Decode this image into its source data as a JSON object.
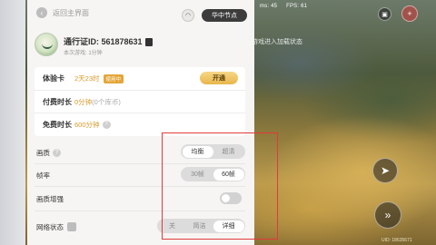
{
  "hud": {
    "fps": "FPS: 61",
    "ping": "ms: 45",
    "overlay_text": "云游戏进入加载状态",
    "bottom_text": "UID: 18635671"
  },
  "header": {
    "back_label": "返回主界面",
    "node_label": "华中节点"
  },
  "profile": {
    "pass_id": "通行证ID: 561878631",
    "session": "本次游戏: 1分钟"
  },
  "account": {
    "trial": {
      "label": "体验卡",
      "value": "2天23时",
      "badge": "使用中",
      "button": "开通"
    },
    "paid": {
      "label": "付费时长",
      "value": "0分钟",
      "suffix": "(0个库币)"
    },
    "free": {
      "label": "免费时长",
      "value": "600分钟"
    }
  },
  "settings": {
    "quality": {
      "label": "画质",
      "options": [
        "均衡",
        "超清"
      ],
      "selected": "均衡"
    },
    "framerate": {
      "label": "帧率",
      "options": [
        "30帧",
        "60帧"
      ],
      "selected": "60帧"
    },
    "enhance": {
      "label": "画质增强",
      "enabled": false
    },
    "netstatus": {
      "label": "网络状态",
      "options": [
        "关",
        "简洁",
        "详细"
      ],
      "selected": "详细"
    }
  },
  "icons": {
    "back": "back-arrow-icon",
    "headset": "headset-icon",
    "help": "question-icon",
    "copy": "copy-icon",
    "status": "network-icon"
  },
  "colors": {
    "accent_gold": "#e8b64c",
    "highlight_red": "#e23a3a",
    "panel_bg": "#f6f5f3"
  }
}
